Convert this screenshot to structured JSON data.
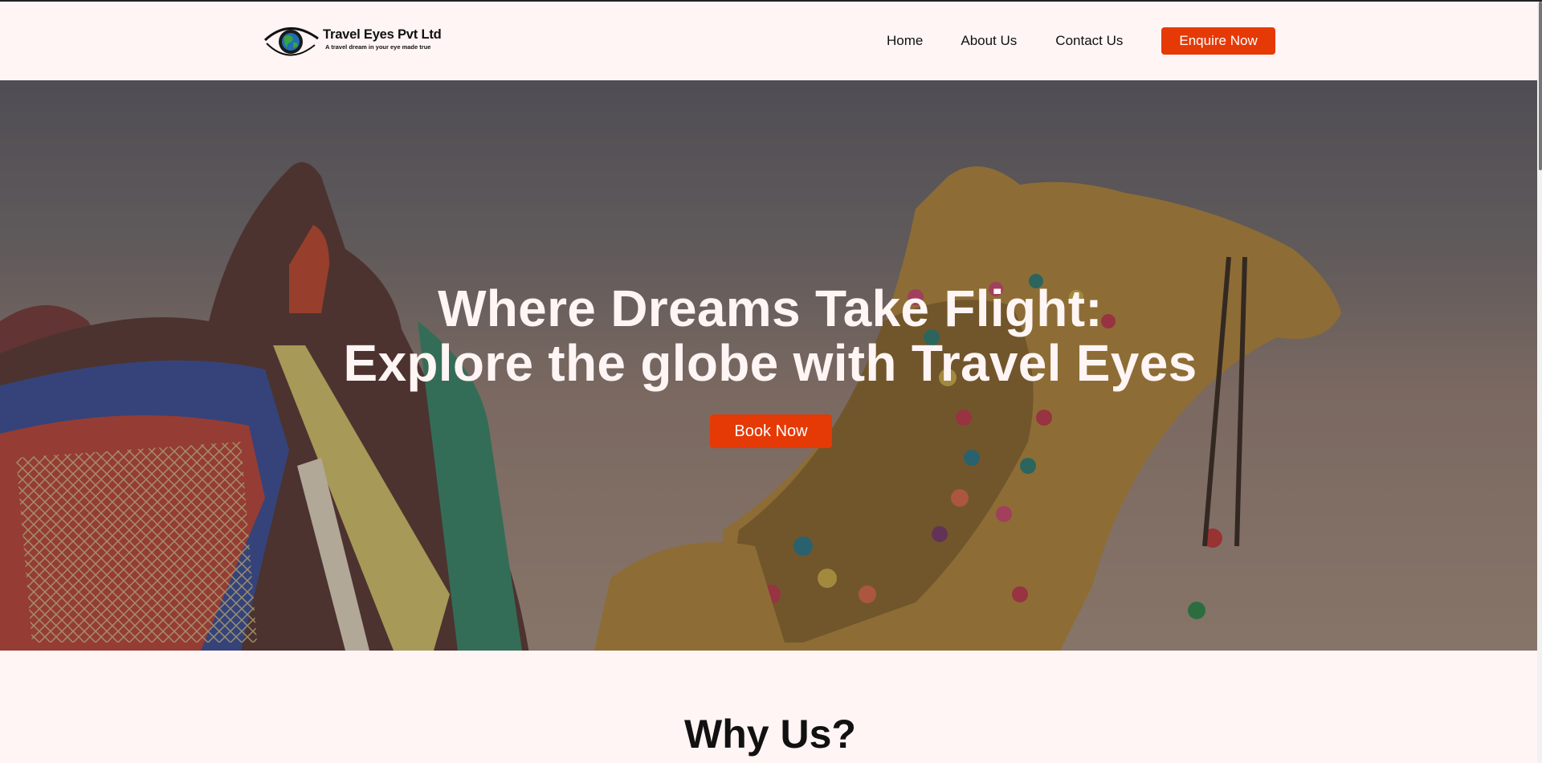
{
  "header": {
    "brand_name": "Travel Eyes Pvt Ltd",
    "tagline": "A travel dream in your eye made true",
    "logo_icon": "eye-globe-icon",
    "nav": {
      "home": "Home",
      "about": "About Us",
      "contact": "Contact Us"
    },
    "enquire_label": "Enquire Now"
  },
  "hero": {
    "title_line1": "Where Dreams Take Flight:",
    "title_line2": "Explore the globe with Travel Eyes",
    "book_label": "Book Now"
  },
  "sections": {
    "why_us_heading": "Why Us?"
  },
  "colors": {
    "accent": "#e53906",
    "background": "#fff5f4",
    "text": "#111111"
  }
}
